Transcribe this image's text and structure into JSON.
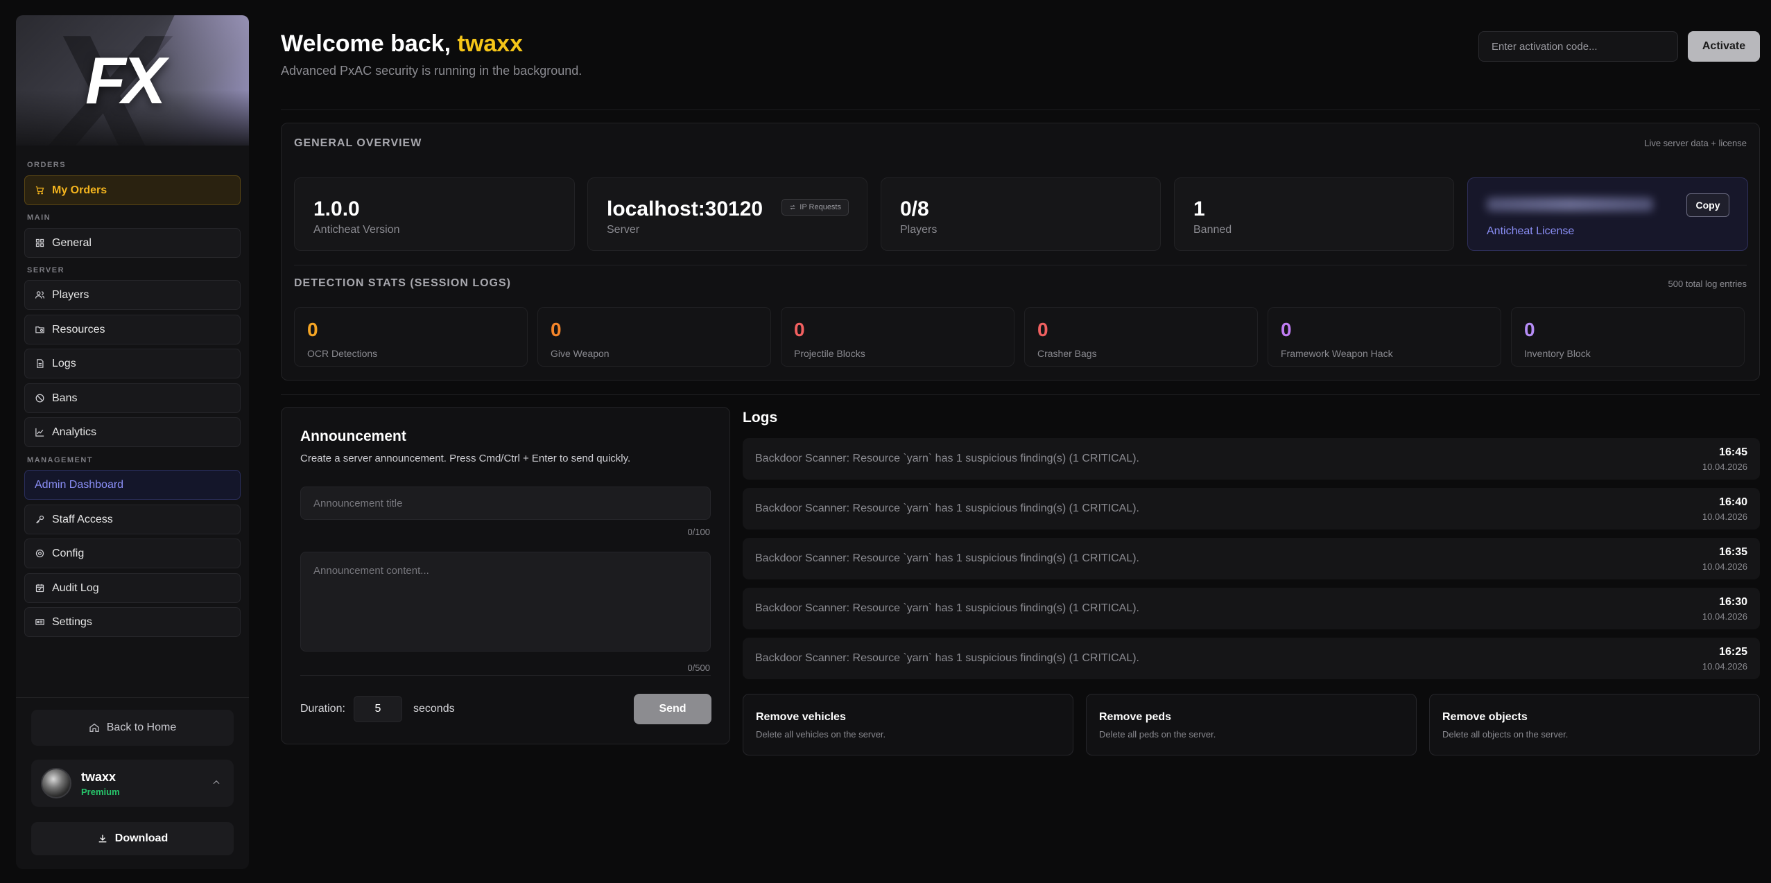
{
  "sidebar": {
    "logo_text": "FX",
    "sections": {
      "orders": "ORDERS",
      "main": "MAIN",
      "server": "SERVER",
      "management": "MANAGEMENT"
    },
    "items": [
      {
        "label": "My Orders",
        "icon": "cart-icon"
      },
      {
        "label": "General",
        "icon": "grid-icon"
      },
      {
        "label": "Players",
        "icon": "users-icon"
      },
      {
        "label": "Resources",
        "icon": "folder-icon"
      },
      {
        "label": "Logs",
        "icon": "file-icon"
      },
      {
        "label": "Bans",
        "icon": "ban-icon"
      },
      {
        "label": "Analytics",
        "icon": "chart-icon"
      },
      {
        "label": "Admin Dashboard",
        "icon": ""
      },
      {
        "label": "Staff Access",
        "icon": "key-icon"
      },
      {
        "label": "Config",
        "icon": "gear-icon"
      },
      {
        "label": "Audit Log",
        "icon": "calendar-icon"
      },
      {
        "label": "Settings",
        "icon": "id-card-icon"
      }
    ],
    "back_home": "Back to Home",
    "user": {
      "name": "twaxx",
      "tier": "Premium"
    },
    "download": "Download"
  },
  "header": {
    "welcome_prefix": "Welcome back, ",
    "username": "twaxx",
    "subtitle": "Advanced PxAC security is running in the background.",
    "activation_placeholder": "Enter activation code...",
    "activate_label": "Activate"
  },
  "overview": {
    "title": "GENERAL OVERVIEW",
    "meta": "Live server data + license",
    "cards": {
      "version": {
        "value": "1.0.0",
        "label": "Anticheat Version"
      },
      "server": {
        "value": "localhost:30120",
        "label": "Server",
        "badge": "IP Requests"
      },
      "players": {
        "value": "0/8",
        "label": "Players"
      },
      "banned": {
        "value": "1",
        "label": "Banned"
      },
      "license": {
        "label": "Anticheat License",
        "copy_label": "Copy"
      }
    }
  },
  "detection": {
    "title": "DETECTION STATS (SESSION LOGS)",
    "meta": "500 total log entries",
    "stats": [
      {
        "value": "0",
        "label": "OCR Detections",
        "color": "#f5a524"
      },
      {
        "value": "0",
        "label": "Give Weapon",
        "color": "#f5852a"
      },
      {
        "value": "0",
        "label": "Projectile Blocks",
        "color": "#f26060"
      },
      {
        "value": "0",
        "label": "Crasher Bags",
        "color": "#f06060"
      },
      {
        "value": "0",
        "label": "Framework Weapon Hack",
        "color": "#c07cf2"
      },
      {
        "value": "0",
        "label": "Inventory Block",
        "color": "#b58cf5"
      }
    ]
  },
  "announcement": {
    "title": "Announcement",
    "description": "Create a server announcement. Press Cmd/Ctrl + Enter to send quickly.",
    "title_placeholder": "Announcement title",
    "title_counter": "0/100",
    "content_placeholder": "Announcement content...",
    "content_counter": "0/500",
    "duration_label": "Duration:",
    "duration_value": "5",
    "duration_unit": "seconds",
    "send_label": "Send"
  },
  "logs": {
    "title": "Logs",
    "entries": [
      {
        "message": "Backdoor Scanner: Resource `yarn` has 1 suspicious finding(s) (1 CRITICAL).",
        "time": "16:45",
        "date": "10.04.2026"
      },
      {
        "message": "Backdoor Scanner: Resource `yarn` has 1 suspicious finding(s) (1 CRITICAL).",
        "time": "16:40",
        "date": "10.04.2026"
      },
      {
        "message": "Backdoor Scanner: Resource `yarn` has 1 suspicious finding(s) (1 CRITICAL).",
        "time": "16:35",
        "date": "10.04.2026"
      },
      {
        "message": "Backdoor Scanner: Resource `yarn` has 1 suspicious finding(s) (1 CRITICAL).",
        "time": "16:30",
        "date": "10.04.2026"
      },
      {
        "message": "Backdoor Scanner: Resource `yarn` has 1 suspicious finding(s) (1 CRITICAL).",
        "time": "16:25",
        "date": "10.04.2026"
      }
    ]
  },
  "actions": [
    {
      "title": "Remove vehicles",
      "description": "Delete all vehicles on the server."
    },
    {
      "title": "Remove peds",
      "description": "Delete all peds on the server."
    },
    {
      "title": "Remove objects",
      "description": "Delete all objects on the server."
    }
  ]
}
